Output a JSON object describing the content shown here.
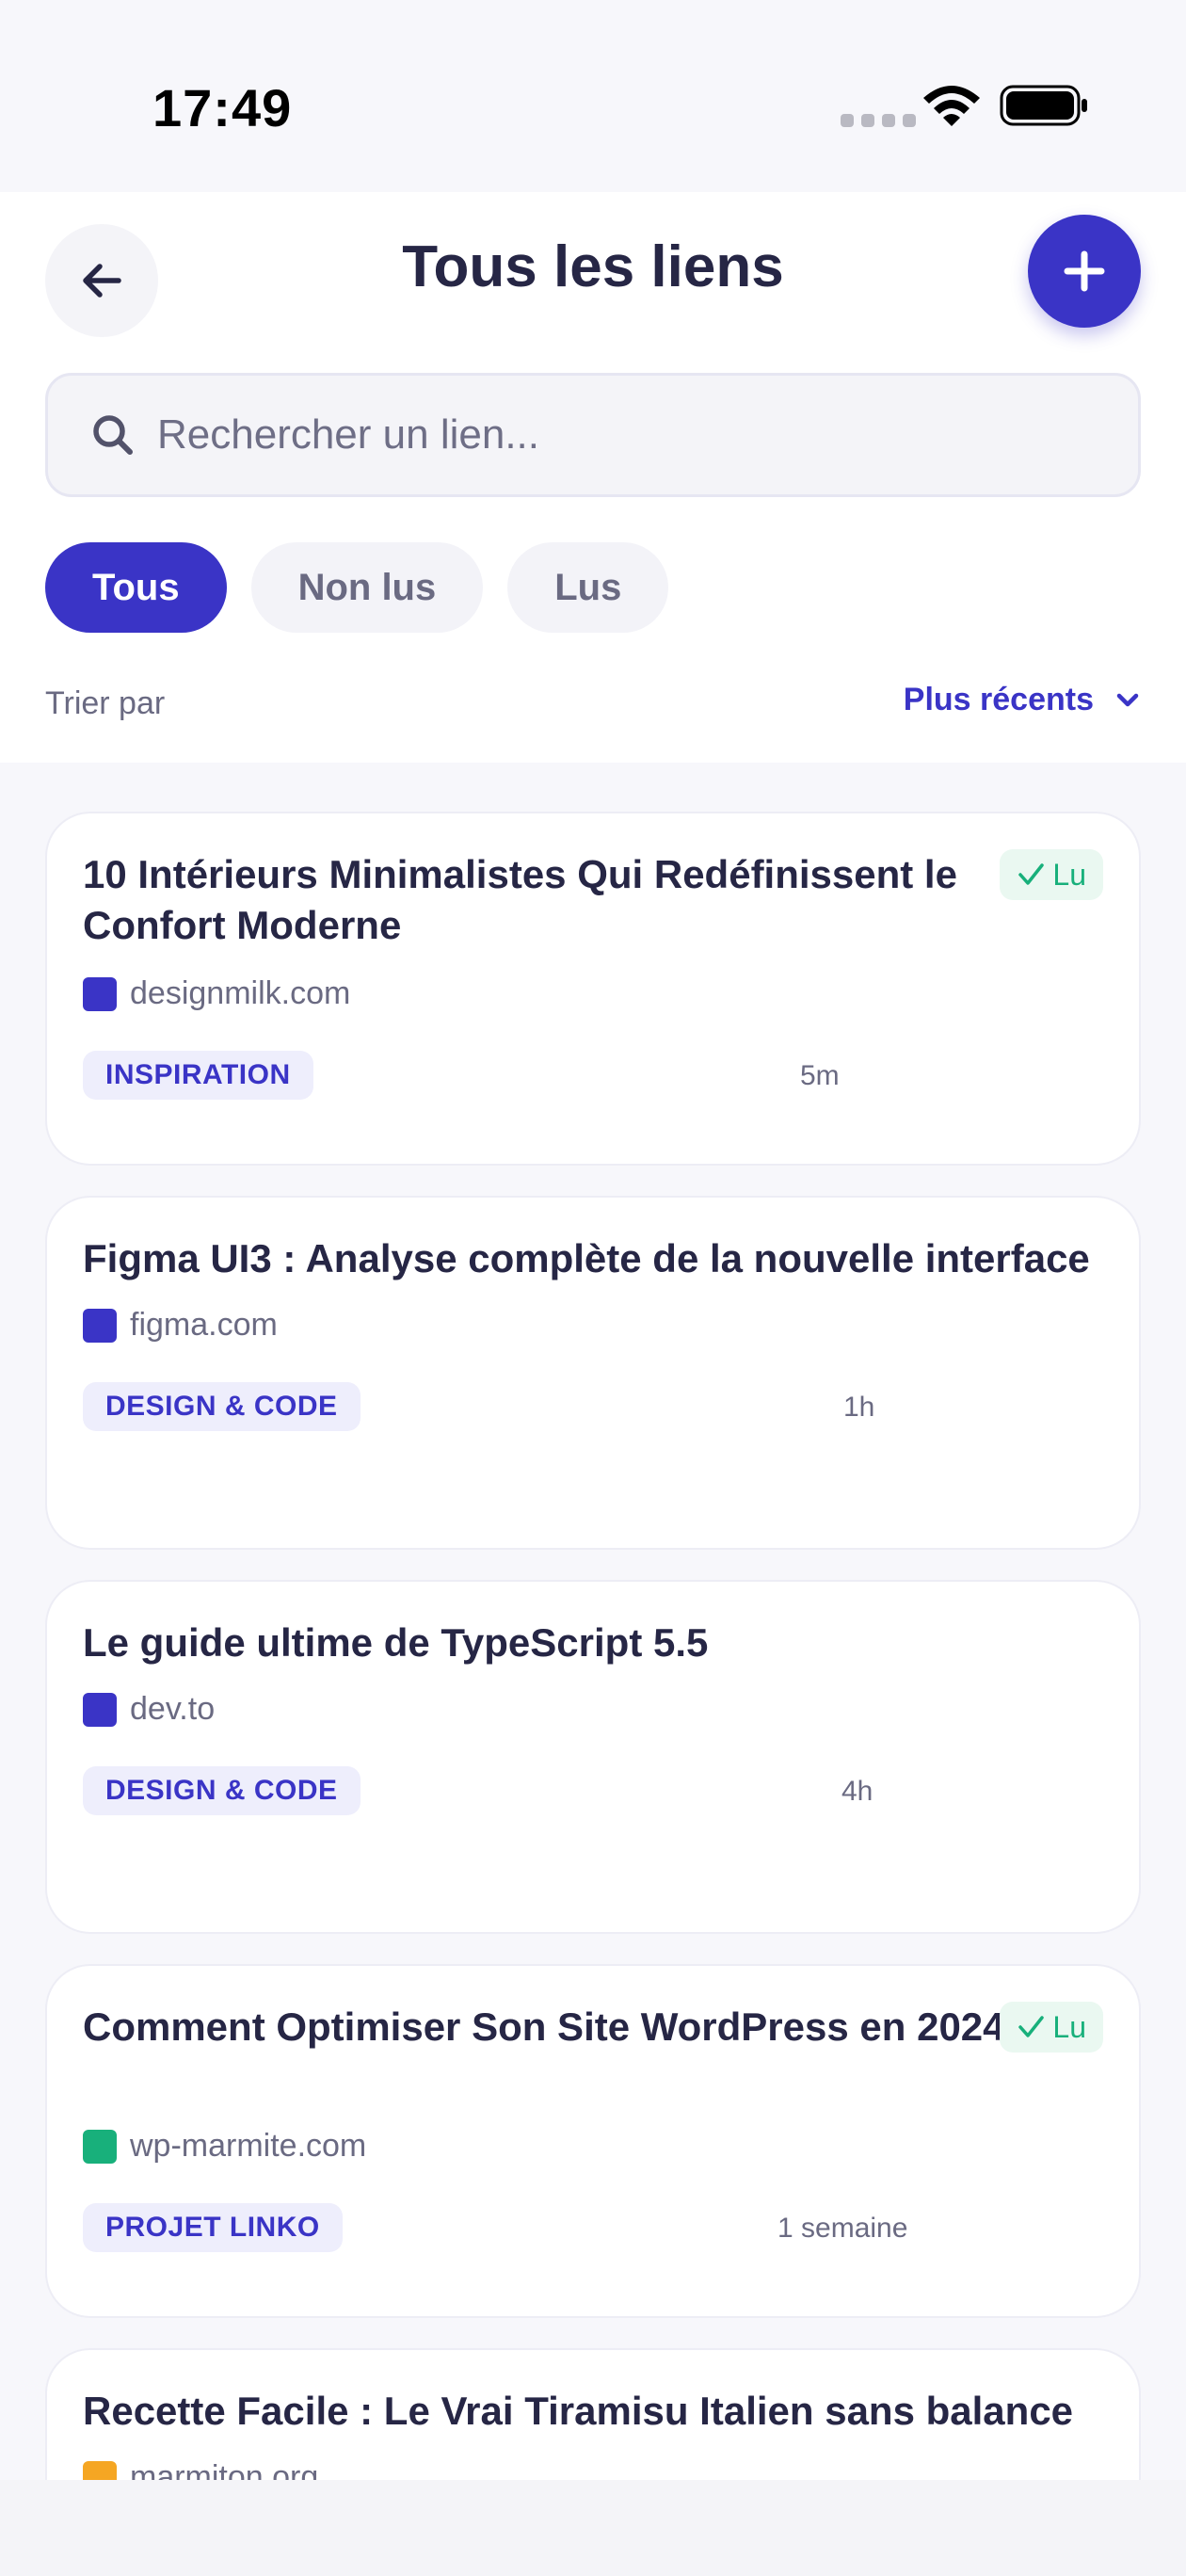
{
  "status_bar": {
    "time": "17:49"
  },
  "header": {
    "title": "Tous les liens",
    "search": {
      "placeholder": "Rechercher un lien..."
    },
    "filters": [
      {
        "label": "Tous",
        "active": true
      },
      {
        "label": "Non lus",
        "active": false
      },
      {
        "label": "Lus",
        "active": false
      }
    ],
    "sort": {
      "label": "Trier par",
      "value": "Plus récents"
    }
  },
  "links": [
    {
      "title": "10 Intérieurs Minimalistes Qui Redéfinissent le Confort Moderne",
      "read_label": "Lu",
      "domain": "designmilk.com",
      "domain_color": "#3a34c6",
      "tag": "INSPIRATION",
      "time": "5m"
    },
    {
      "title": "Figma UI3 : Analyse complète de la nouvelle interface",
      "read_label": "",
      "domain": "figma.com",
      "domain_color": "#3a34c6",
      "tag": "DESIGN & CODE",
      "time": "1h"
    },
    {
      "title": "Le guide ultime de TypeScript 5.5",
      "read_label": "",
      "domain": "dev.to",
      "domain_color": "#3a34c6",
      "tag": "DESIGN & CODE",
      "time": "4h"
    },
    {
      "title": "Comment Optimiser Son Site WordPress en 2024",
      "read_label": "Lu",
      "domain": "wp-marmite.com",
      "domain_color": "#18b07b",
      "tag": "PROJET LINKO",
      "time": "1 semaine"
    },
    {
      "title": "Recette Facile : Le Vrai Tiramisu Italien sans balance",
      "read_label": "",
      "domain": "marmiton.org",
      "domain_color": "#f5a623",
      "tag": "",
      "time": ""
    }
  ],
  "colors": {
    "accent": "#3a34c6",
    "read_green": "#18b07b",
    "title_text": "#262645",
    "muted_text": "#6a6a82"
  }
}
